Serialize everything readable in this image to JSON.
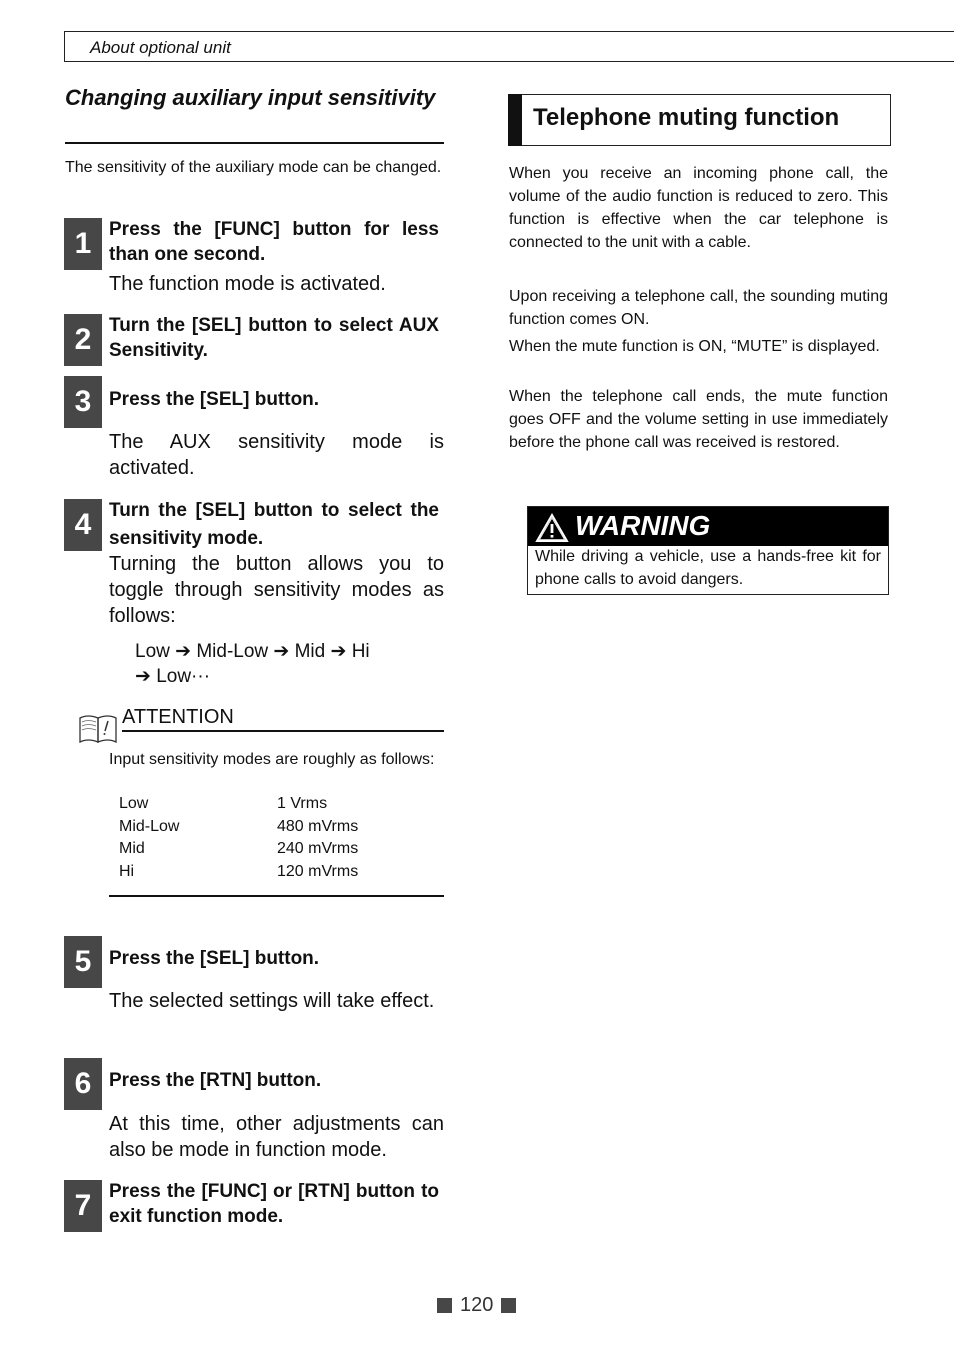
{
  "header": {
    "section": "About optional unit"
  },
  "left": {
    "title": "Changing auxiliary input sensitivity",
    "intro": "The sensitivity of the auxiliary mode can be changed.",
    "steps": [
      {
        "num": "1",
        "head": "Press the [FUNC] button for less than one second.",
        "body": "The function mode is activated."
      },
      {
        "num": "2",
        "head": "Turn the [SEL] button to select AUX Sensitivity.",
        "body": ""
      },
      {
        "num": "3",
        "head": "Press the [SEL] button.",
        "body": "The AUX sensitivity mode is activated."
      },
      {
        "num": "4",
        "head": "Turn the [SEL] button to select the sensitivity mode.",
        "body": "Turning the button allows you to toggle through sensitivity modes as follows:"
      },
      {
        "num": "5",
        "head": "Press the [SEL] button.",
        "body": "The selected settings will take effect."
      },
      {
        "num": "6",
        "head": "Press the [RTN] button.",
        "body": "At this time, other adjustments can also be mode in function mode."
      },
      {
        "num": "7",
        "head": "Press the [FUNC] or [RTN] button to exit function mode.",
        "body": ""
      }
    ],
    "sequence_line1": "Low ➔ Mid-Low ➔ Mid ➔ Hi",
    "sequence_line2": "➔  Low···",
    "attention": {
      "title": "ATTENTION",
      "icon": "book-attention-icon",
      "text": "Input sensitivity modes are roughly as follows:",
      "table": [
        {
          "mode": "Low",
          "level": "1 Vrms"
        },
        {
          "mode": "Mid-Low",
          "level": "480 mVrms"
        },
        {
          "mode": "Mid",
          "level": "240 mVrms"
        },
        {
          "mode": "Hi",
          "level": "120 mVrms"
        }
      ]
    }
  },
  "right": {
    "title": "Telephone muting function",
    "paragraphs": [
      "When you receive an incoming phone call, the volume of the audio function is reduced to zero. This function is effective when the car telephone is connected to the unit with a cable.",
      "Upon receiving a telephone call, the sounding muting function comes ON.",
      "When the mute function is ON, “MUTE” is displayed.",
      "When the telephone call ends, the mute function goes OFF and the volume setting in use immediately before the phone call was received is restored."
    ],
    "warning": {
      "icon": "warning-triangle-icon",
      "title": "WARNING",
      "text": "While driving a vehicle, use a hands-free kit for phone calls to avoid dangers."
    }
  },
  "footer": {
    "page_number": "120"
  }
}
